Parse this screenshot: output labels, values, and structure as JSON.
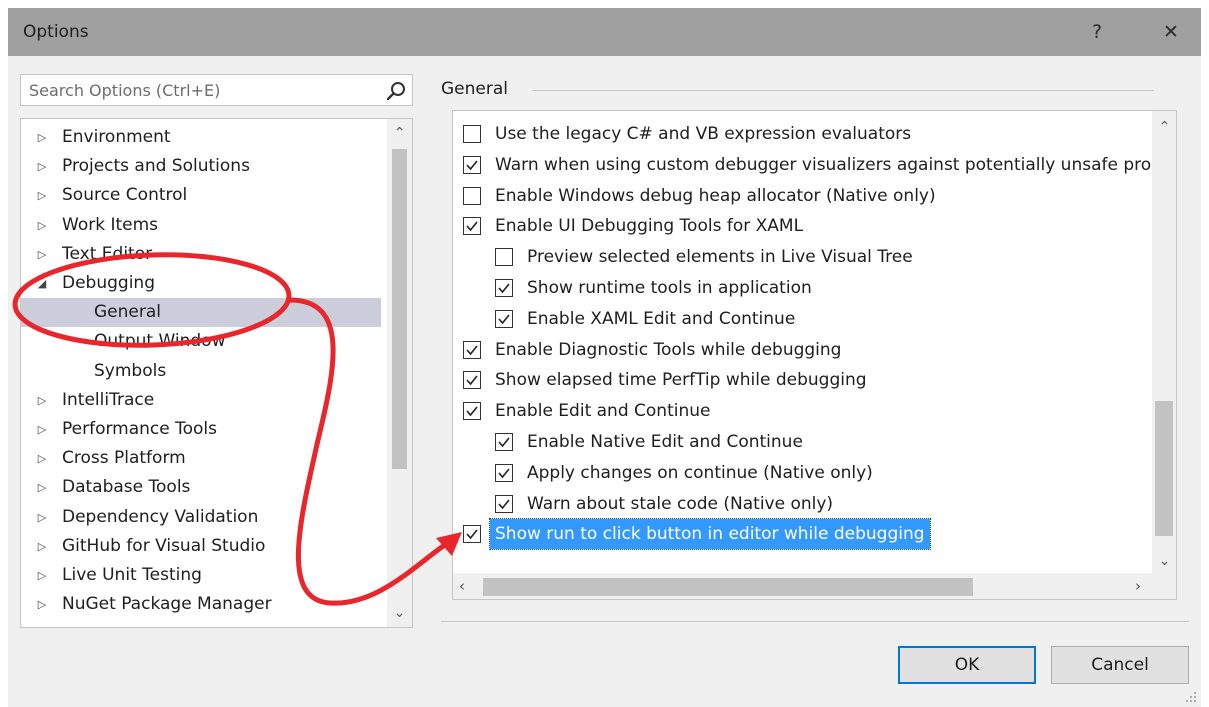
{
  "window": {
    "title": "Options",
    "help_label": "?",
    "close_label": "✕"
  },
  "search": {
    "placeholder": "Search Options (Ctrl+E)",
    "icon": "search-icon"
  },
  "tree": {
    "items": [
      {
        "label": "Environment",
        "state": "collapsed",
        "level": 0
      },
      {
        "label": "Projects and Solutions",
        "state": "collapsed",
        "level": 0
      },
      {
        "label": "Source Control",
        "state": "collapsed",
        "level": 0
      },
      {
        "label": "Work Items",
        "state": "collapsed",
        "level": 0
      },
      {
        "label": "Text Editor",
        "state": "collapsed",
        "level": 0
      },
      {
        "label": "Debugging",
        "state": "expanded",
        "level": 0
      },
      {
        "label": "General",
        "state": "leaf",
        "level": 1,
        "selected": true
      },
      {
        "label": "Output Window",
        "state": "leaf",
        "level": 1
      },
      {
        "label": "Symbols",
        "state": "leaf",
        "level": 1
      },
      {
        "label": "IntelliTrace",
        "state": "collapsed",
        "level": 0
      },
      {
        "label": "Performance Tools",
        "state": "collapsed",
        "level": 0
      },
      {
        "label": "Cross Platform",
        "state": "collapsed",
        "level": 0
      },
      {
        "label": "Database Tools",
        "state": "collapsed",
        "level": 0
      },
      {
        "label": "Dependency Validation",
        "state": "collapsed",
        "level": 0
      },
      {
        "label": "GitHub for Visual Studio",
        "state": "collapsed",
        "level": 0
      },
      {
        "label": "Live Unit Testing",
        "state": "collapsed",
        "level": 0
      },
      {
        "label": "NuGet Package Manager",
        "state": "collapsed",
        "level": 0
      }
    ]
  },
  "general": {
    "title": "General",
    "options": [
      {
        "label": "Use the legacy C# and VB expression evaluators",
        "checked": false,
        "level": 0
      },
      {
        "label": "Warn when using custom debugger visualizers against potentially unsafe pro",
        "checked": true,
        "level": 0
      },
      {
        "label": "Enable Windows debug heap allocator (Native only)",
        "checked": false,
        "level": 0
      },
      {
        "label": "Enable UI Debugging Tools for XAML",
        "checked": true,
        "level": 0
      },
      {
        "label": "Preview selected elements in Live Visual Tree",
        "checked": false,
        "level": 1
      },
      {
        "label": "Show runtime tools in application",
        "checked": true,
        "level": 1
      },
      {
        "label": "Enable XAML Edit and Continue",
        "checked": true,
        "level": 1
      },
      {
        "label": "Enable Diagnostic Tools while debugging",
        "checked": true,
        "level": 0
      },
      {
        "label": "Show elapsed time PerfTip while debugging",
        "checked": true,
        "level": 0
      },
      {
        "label": "Enable Edit and Continue",
        "checked": true,
        "level": 0
      },
      {
        "label": "Enable Native Edit and Continue",
        "checked": true,
        "level": 1
      },
      {
        "label": "Apply changes on continue (Native only)",
        "checked": true,
        "level": 1
      },
      {
        "label": "Warn about stale code (Native only)",
        "checked": true,
        "level": 1
      },
      {
        "label": "Show run to click button in editor while debugging",
        "checked": true,
        "level": 0,
        "highlighted": true
      }
    ]
  },
  "buttons": {
    "ok": "OK",
    "cancel": "Cancel"
  },
  "colors": {
    "titlebar": "#a0a0a0",
    "selection": "#cccedb",
    "highlight": "#3399ff",
    "annotation": "#e8262c",
    "default_button_border": "#0078d7"
  }
}
